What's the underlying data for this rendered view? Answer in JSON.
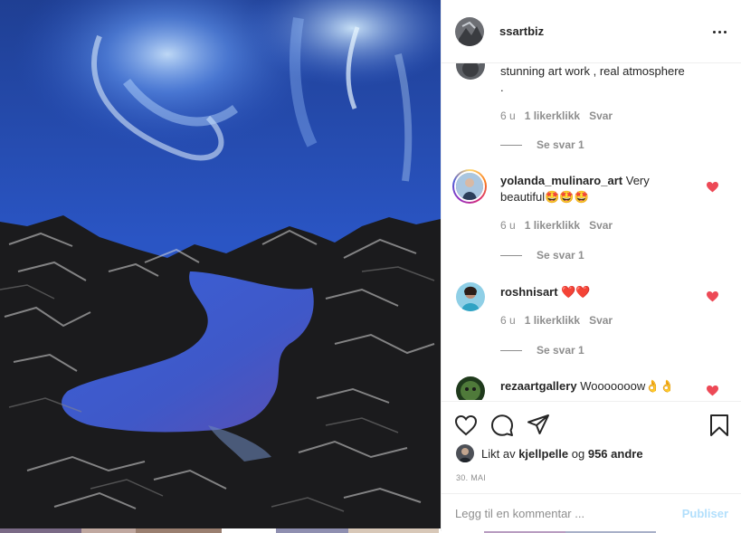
{
  "post": {
    "username": "ssartbiz",
    "more_icon": "more-horizontal-icon"
  },
  "comments": [
    {
      "username": "",
      "text": "stunning art work , real atmosphere .",
      "age": "6 u",
      "likes": "1 likerklikk",
      "reply": "Svar",
      "replies": "Se svar 1",
      "liked": false
    },
    {
      "username": "yolanda_mulinaro_art",
      "text": "Very beautiful🤩🤩🤩",
      "age": "6 u",
      "likes": "1 likerklikk",
      "reply": "Svar",
      "replies": "Se svar 1",
      "liked": true
    },
    {
      "username": "roshnisart",
      "text": "❤️❤️",
      "age": "6 u",
      "likes": "1 likerklikk",
      "reply": "Svar",
      "replies": "Se svar 1",
      "liked": true
    },
    {
      "username": "rezaartgallery",
      "text": "Wooooooow👌👌",
      "liked": true
    }
  ],
  "actions": {
    "like_icon": "heart-outline-icon",
    "comment_icon": "comment-icon",
    "share_icon": "paper-plane-icon",
    "save_icon": "bookmark-icon"
  },
  "likes": {
    "prefix": "Likt av",
    "user": "kjellpelle",
    "joiner": "og",
    "others": "956 andre"
  },
  "date": "30. MAI",
  "add_comment": {
    "placeholder": "Legg til en kommentar ...",
    "publish_label": "Publiser"
  },
  "colors": {
    "like_red": "#ed4956",
    "muted": "#8e8e8e",
    "publish_disabled": "#b2dffc"
  }
}
